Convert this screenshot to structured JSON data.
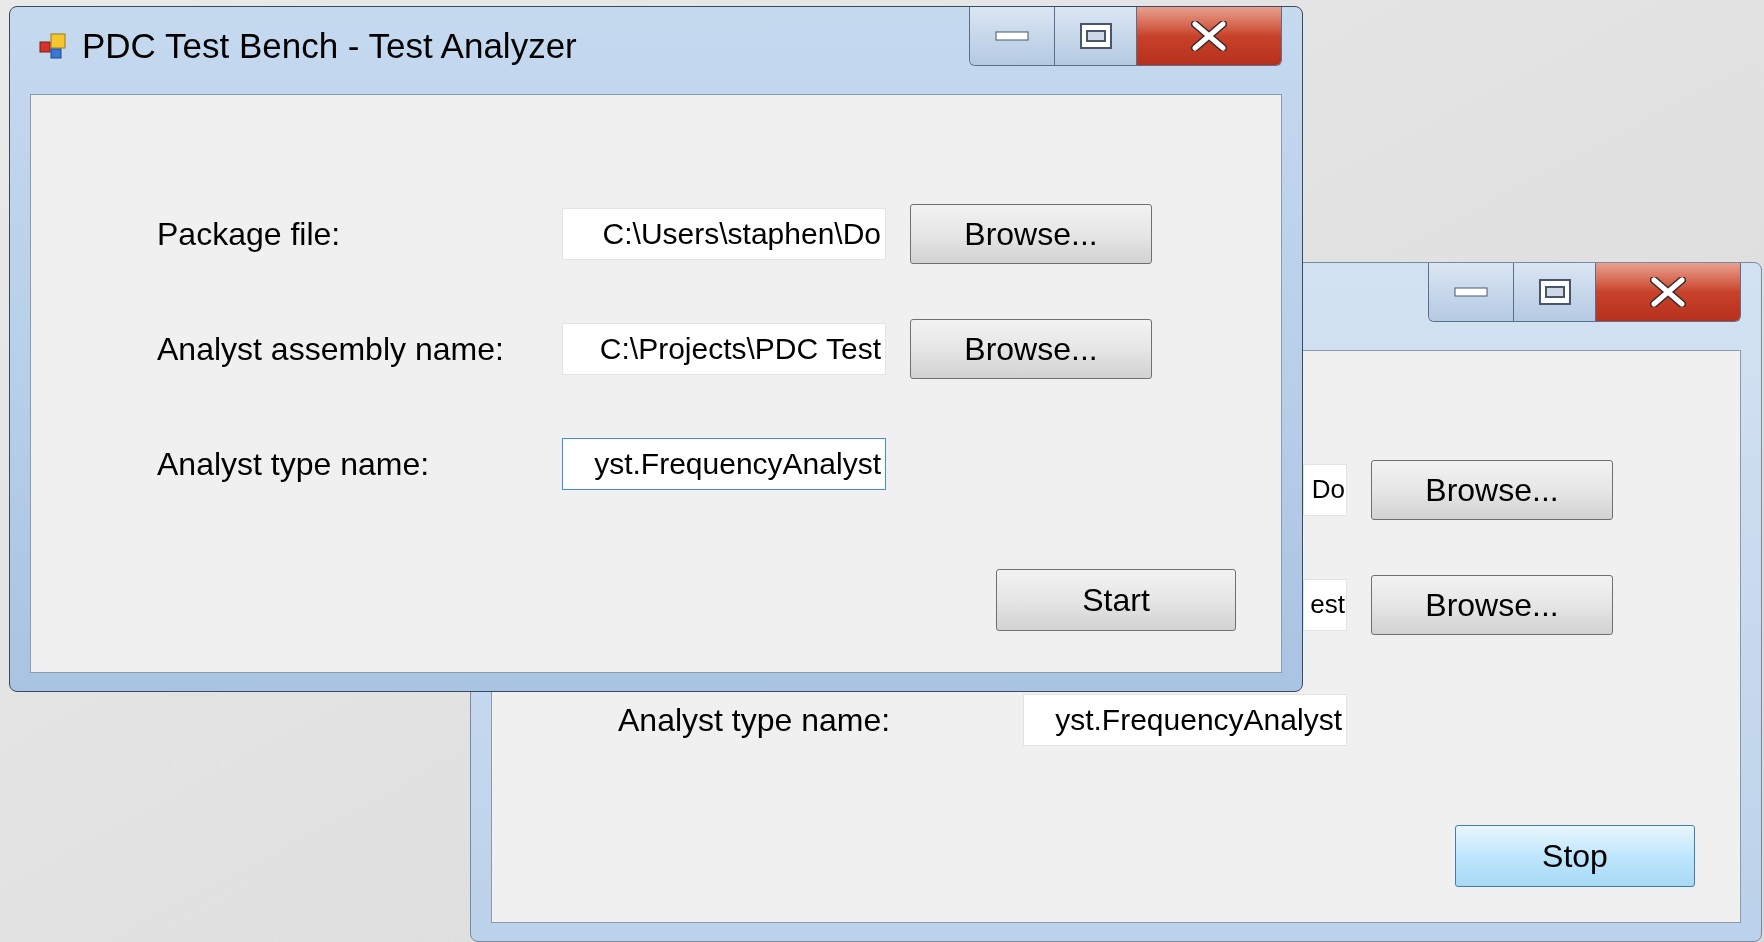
{
  "windows": [
    {
      "title": "PDC Test Bench - Test Analyzer",
      "active": true,
      "rows": [
        {
          "label": "Package file:",
          "field": {
            "value": "C:\\Users\\staphen\\Do",
            "focused": false
          },
          "button": "Browse..."
        },
        {
          "label": "Analyst assembly name:",
          "field": {
            "value": "C:\\Projects\\PDC Test",
            "focused": false
          },
          "button": "Browse..."
        },
        {
          "label": "Analyst type name:",
          "field": {
            "value": "yst.FrequencyAnalyst",
            "focused": true
          }
        }
      ],
      "action_button": {
        "label": "Start",
        "highlighted": false
      }
    },
    {
      "active": false,
      "rows": [
        {
          "field": {
            "value": "Do",
            "focused": false
          },
          "button": "Browse..."
        },
        {
          "field": {
            "value": "est",
            "focused": false
          },
          "button": "Browse..."
        },
        {
          "label": "Analyst type name:",
          "field": {
            "value": "yst.FrequencyAnalyst",
            "focused": false
          }
        }
      ],
      "action_button": {
        "label": "Stop",
        "highlighted": true
      }
    }
  ]
}
